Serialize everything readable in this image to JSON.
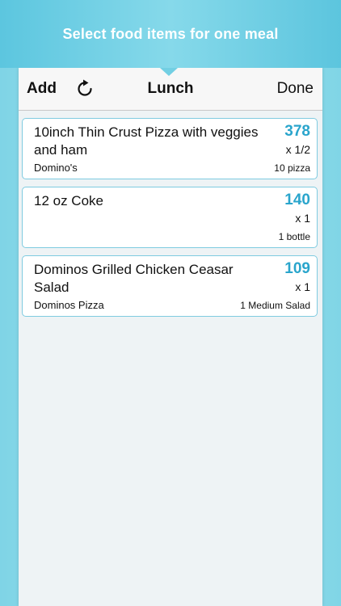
{
  "banner": {
    "text": "Select food items for one meal"
  },
  "navbar": {
    "add_label": "Add",
    "refresh_icon": "refresh-icon",
    "title": "Lunch",
    "done_label": "Done"
  },
  "items": [
    {
      "name": "10inch Thin Crust Pizza with veggies and ham",
      "calories": "378",
      "multiplier": "x 1/2",
      "brand": "Domino's",
      "serving": "10 pizza"
    },
    {
      "name": "12 oz Coke",
      "calories": "140",
      "multiplier": "x 1",
      "brand": "",
      "serving": "1 bottle"
    },
    {
      "name": "Dominos Grilled Chicken Ceasar Salad",
      "calories": "109",
      "multiplier": "x 1",
      "brand": "Dominos Pizza",
      "serving": "1 Medium Salad"
    }
  ],
  "colors": {
    "accent": "#2aa5cc",
    "banner": "#72cfe3",
    "card_border": "#7fcbe0"
  }
}
